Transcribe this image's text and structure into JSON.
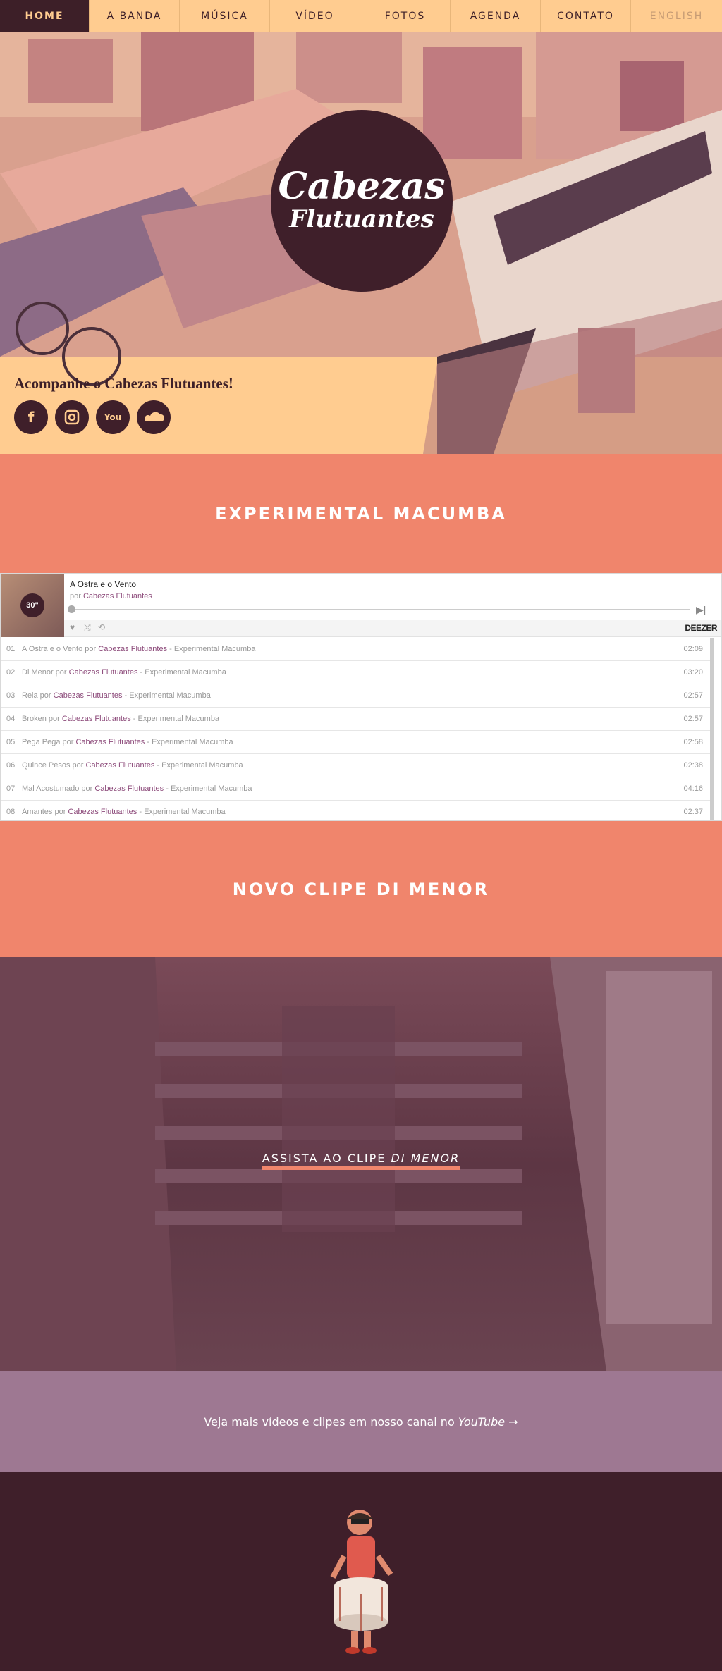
{
  "nav": {
    "items": [
      "HOME",
      "A BANDA",
      "MÚSICA",
      "VÍDEO",
      "FOTOS",
      "AGENDA",
      "CONTATO",
      "ENGLISH"
    ]
  },
  "hero": {
    "logo_line1": "Cabezas",
    "logo_line2": "Flutuantes",
    "follow_text": "Acompanhe o Cabezas Flutuantes!",
    "social_icons": [
      "facebook-icon",
      "instagram-icon",
      "youtube-icon",
      "soundcloud-icon"
    ]
  },
  "album_section": {
    "title": "EXPERIMENTAL MACUMBA"
  },
  "player": {
    "cover_badge": "30\"",
    "current_title": "A Ostra e o Vento",
    "by_label": "por",
    "current_artist": "Cabezas Flutuantes",
    "brand": "DEEZER",
    "tracks": [
      {
        "num": "01",
        "title": "A Ostra e o Vento",
        "artist": "Cabezas Flutuantes",
        "album": "Experimental Macumba",
        "duration": "02:09"
      },
      {
        "num": "02",
        "title": "Di Menor",
        "artist": "Cabezas Flutuantes",
        "album": "Experimental Macumba",
        "duration": "03:20"
      },
      {
        "num": "03",
        "title": "Rela",
        "artist": "Cabezas Flutuantes",
        "album": "Experimental Macumba",
        "duration": "02:57"
      },
      {
        "num": "04",
        "title": "Broken",
        "artist": "Cabezas Flutuantes",
        "album": "Experimental Macumba",
        "duration": "02:57"
      },
      {
        "num": "05",
        "title": "Pega Pega",
        "artist": "Cabezas Flutuantes",
        "album": "Experimental Macumba",
        "duration": "02:58"
      },
      {
        "num": "06",
        "title": "Quince Pesos",
        "artist": "Cabezas Flutuantes",
        "album": "Experimental Macumba",
        "duration": "02:38"
      },
      {
        "num": "07",
        "title": "Mal Acostumado",
        "artist": "Cabezas Flutuantes",
        "album": "Experimental Macumba",
        "duration": "04:16"
      },
      {
        "num": "08",
        "title": "Amantes",
        "artist": "Cabezas Flutuantes",
        "album": "Experimental Macumba",
        "duration": "02:37"
      }
    ]
  },
  "clip_section": {
    "title": "NOVO CLIPE DI MENOR"
  },
  "video": {
    "cta_prefix": "ASSISTA AO CLIPE ",
    "cta_title": "DI MENOR"
  },
  "more_videos": {
    "text": "Veja mais vídeos e clipes em nosso canal no ",
    "channel": "YouTube",
    "arrow": "→"
  },
  "colors": {
    "dark_plum": "#3f1f2a",
    "peach": "#ffcc90",
    "coral": "#f0856c",
    "mauve": "#9e7892",
    "link_purple": "#8c4a7a"
  }
}
